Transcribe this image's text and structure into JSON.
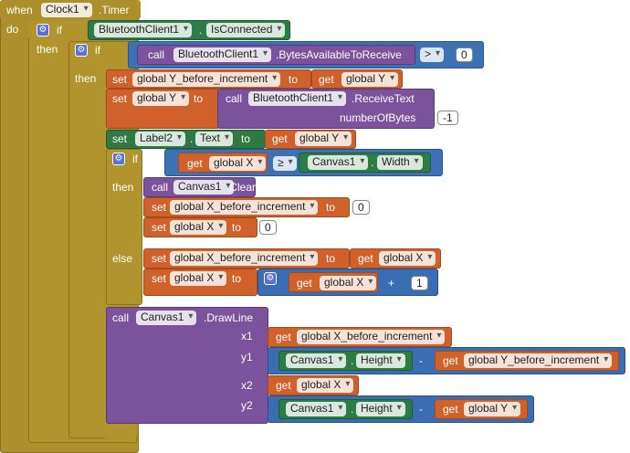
{
  "event": {
    "when": "when",
    "component": "Clock1",
    "event_name": ".Timer",
    "do": "do"
  },
  "if1": {
    "if_label": "if",
    "then_label": "then",
    "component": "BluetoothClient1",
    "property": "IsConnected"
  },
  "if2": {
    "if_label": "if",
    "then_label": "then",
    "call": "call",
    "component": "BluetoothClient1",
    "method": ".BytesAvailableToReceive",
    "op": ">",
    "value": "0"
  },
  "set_y_before": {
    "set": "set",
    "var": "global Y_before_increment",
    "to": "to",
    "get": "get",
    "get_var": "global Y"
  },
  "set_y": {
    "set": "set",
    "var": "global Y",
    "to": "to",
    "call": "call",
    "component": "BluetoothClient1",
    "method": ".ReceiveText",
    "arg_label": "numberOfBytes",
    "arg_value": "-1"
  },
  "set_label": {
    "set": "set",
    "component": "Label2",
    "property": "Text",
    "to": "to",
    "get": "get",
    "get_var": "global Y"
  },
  "if3": {
    "if_label": "if",
    "then_label": "then",
    "else_label": "else",
    "get": "get",
    "get_var": "global X",
    "op": "≥",
    "component": "Canvas1",
    "property": "Width"
  },
  "then3": {
    "call": "call",
    "component": "Canvas1",
    "method": ".Clear",
    "set1_set": "set",
    "set1_var": "global X_before_increment",
    "set1_to": "to",
    "set1_value": "0",
    "set2_set": "set",
    "set2_var": "global X",
    "set2_to": "to",
    "set2_value": "0"
  },
  "else3": {
    "set1_set": "set",
    "set1_var": "global X_before_increment",
    "set1_to": "to",
    "set1_get": "get",
    "set1_get_var": "global X",
    "set2_set": "set",
    "set2_var": "global X",
    "set2_to": "to",
    "set2_get": "get",
    "set2_get_var": "global X",
    "op": "+",
    "value": "1"
  },
  "drawline": {
    "call": "call",
    "component": "Canvas1",
    "method": ".DrawLine",
    "x1": "x1",
    "y1": "y1",
    "x2": "x2",
    "y2": "y2",
    "x1_get": "get",
    "x1_var": "global X_before_increment",
    "y1_component": "Canvas1",
    "y1_property": "Height",
    "y1_op": "-",
    "y1_get": "get",
    "y1_var": "global Y_before_increment",
    "x2_get": "get",
    "x2_var": "global X",
    "y2_component": "Canvas1",
    "y2_property": "Height",
    "y2_op": "-",
    "y2_get": "get",
    "y2_var": "global Y"
  },
  "colors": {
    "event": "#ad8f2c",
    "variable": "#d0612a",
    "component_call": "#7b529c",
    "component_prop": "#2d7b45",
    "logic": "#3c71b6",
    "math": "#3b6db2"
  }
}
